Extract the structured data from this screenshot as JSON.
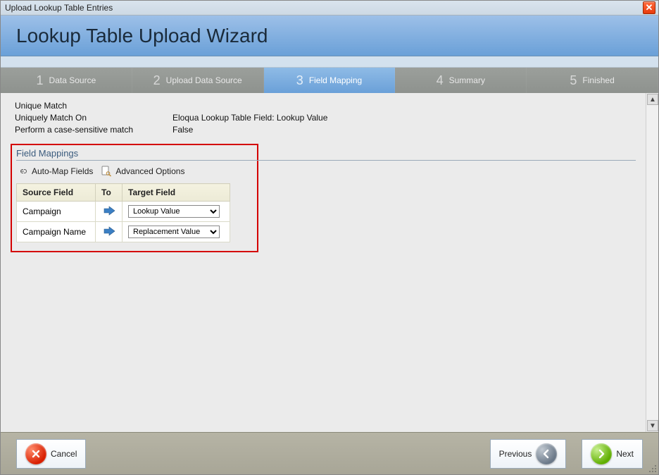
{
  "window": {
    "title": "Upload Lookup Table Entries"
  },
  "header": {
    "title": "Lookup Table Upload Wizard"
  },
  "steps": [
    {
      "num": "1",
      "label": "Data Source"
    },
    {
      "num": "2",
      "label": "Upload Data Source"
    },
    {
      "num": "3",
      "label": "Field Mapping"
    },
    {
      "num": "4",
      "label": "Summary"
    },
    {
      "num": "5",
      "label": "Finished"
    }
  ],
  "match": {
    "line0": "Unique Match",
    "line1_label": "Uniquely Match On",
    "line1_value": "Eloqua Lookup Table Field: Lookup Value",
    "line2_label": "Perform a case-sensitive match",
    "line2_value": "False"
  },
  "mapping": {
    "section_title": "Field Mappings",
    "automap_label": "Auto-Map Fields",
    "advanced_label": "Advanced Options",
    "columns": {
      "source": "Source Field",
      "to": "To",
      "target": "Target Field"
    },
    "rows": [
      {
        "source": "Campaign",
        "target": "Lookup Value"
      },
      {
        "source": "Campaign Name",
        "target": "Replacement Value"
      }
    ]
  },
  "footer": {
    "cancel": "Cancel",
    "previous": "Previous",
    "next": "Next"
  }
}
